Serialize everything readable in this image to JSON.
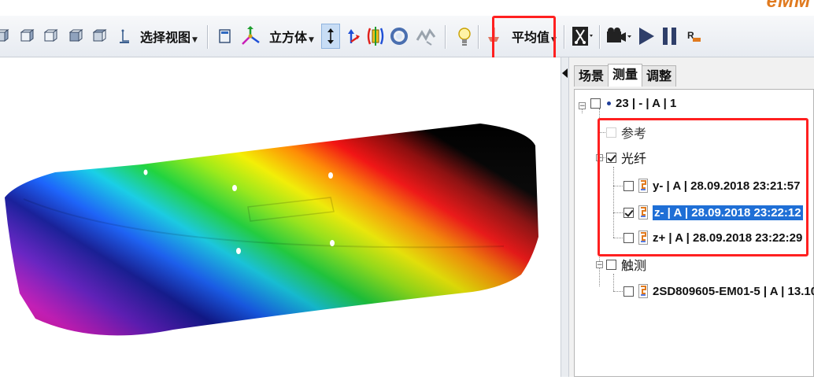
{
  "brand": "eMM",
  "toolbar": {
    "view_select_label": "选择视图",
    "cube_label": "立方体",
    "average_label": "平均值"
  },
  "panel": {
    "tabs": [
      "场景",
      "测量",
      "调整"
    ],
    "active_tab": 1,
    "tree": {
      "root": "23 | - | A | 1",
      "reference": "参考",
      "optical": "光纤",
      "measurements": [
        {
          "label": "y- | A | 28.09.2018 23:21:57",
          "checked": false,
          "selected": false
        },
        {
          "label": "z- | A | 28.09.2018 23:22:12",
          "checked": true,
          "selected": true
        },
        {
          "label": "z+ | A | 28.09.2018 23:22:29",
          "checked": false,
          "selected": false
        }
      ],
      "tactile": "触测",
      "tactile_child": "2SD809605-EM01-5 | A | 13.10"
    }
  },
  "colors": {
    "highlight": "#ff2020",
    "selection": "#1f6fd6",
    "brand": "#e07a1f"
  },
  "icons": [
    "view-front-icon",
    "view-back-icon",
    "view-left-icon",
    "view-right-icon",
    "view-top-icon",
    "view-iso-icon",
    "panel-icon",
    "axes-icon",
    "arrow-vertical-icon",
    "arrow-flip-icon",
    "rotate-axis-icon",
    "zoom-icon",
    "graph-icon",
    "light-bulb-icon",
    "pin-icon",
    "scissors-icon",
    "camera-icon",
    "play-icon",
    "pause-icon",
    "record-icon"
  ]
}
